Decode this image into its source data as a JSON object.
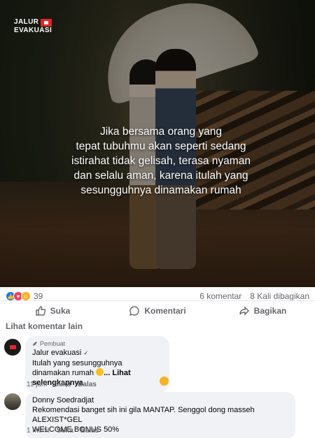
{
  "brand": {
    "line1": "JALUR",
    "line2": "EVAKUASI"
  },
  "post": {
    "quote_lines": [
      "Jika bersama orang yang",
      "tepat tubuhmu akan seperti sedang",
      "istirahat tidak gelisah, terasa nyaman",
      "dan selalu aman, karena itulah yang",
      "sesungguhnya dinamakan rumah"
    ]
  },
  "summary": {
    "reaction_count": "39",
    "comments": "6 komentar",
    "shares": "8 Kali dibagikan"
  },
  "actions": {
    "like": "Suka",
    "comment": "Komentari",
    "share": "Bagikan"
  },
  "more_comments": "Lihat komentar lain",
  "comments": [
    {
      "badge": "Pembuat",
      "author": "Jalur evakuasi",
      "text_line1": "Itulah yang sesungguhnya",
      "text_line2": "dinamakan rumah",
      "see_more": "... Lihat selengkapnya",
      "time": "11 jam",
      "like": "Suka",
      "reply": "Balas"
    },
    {
      "author": "Donny Soedradjat",
      "text_line1": "Rekomendasi banget sih ini gila MANTAP. Senggol dong masseh ALEXIST*GEL",
      "text_line2": "WELCOME BONUS 50%",
      "time": "1 menit",
      "like": "Suka",
      "reply": "Balas"
    }
  ],
  "colors": {
    "like_blue": "#1877f2",
    "love_red": "#f33e58",
    "haha_yellow": "#f7b125",
    "muted_text": "#65676b",
    "bubble_bg": "#f0f2f5"
  },
  "icons": [
    "like-thumb-icon",
    "comment-bubble-icon",
    "share-arrow-icon",
    "pencil-icon",
    "verified-icon",
    "haha-emoji-icon"
  ]
}
